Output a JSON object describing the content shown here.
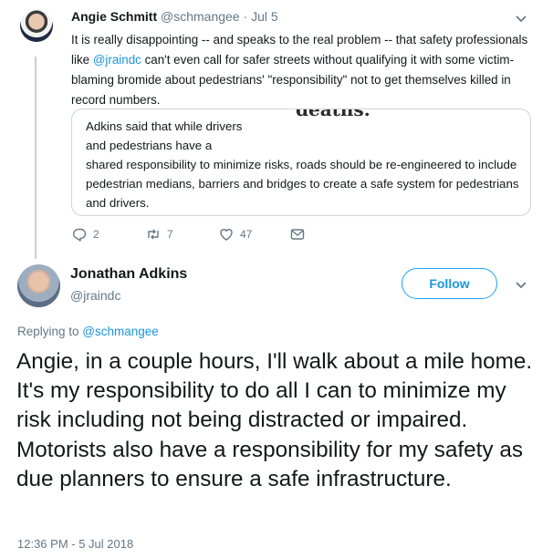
{
  "tweet1": {
    "author_name": "Angie Schmitt",
    "handle": "@schmangee",
    "separator": "·",
    "date": "Jul 5",
    "text_before": "It is really disappointing -- and speaks to the real problem -- that safety professionals like ",
    "mention": "@jraindc",
    "text_after": " can't even call for safer streets without qualifying it with some victim-blaming bromide about pedestrians' \"responsibility\" not to get themselves killed in record numbers.",
    "quote": {
      "headline_fragment": "deaths.",
      "text": "Adkins said that while drivers and pedestrians have a shared responsibility to minimize risks, roads should be re-engineered to include pedestrian medians, barriers and bridges to create a safe system for pedestrians and drivers."
    },
    "actions": {
      "reply_icon": "reply-icon",
      "reply_count": "2",
      "retweet_icon": "retweet-icon",
      "retweet_count": "7",
      "like_icon": "heart-icon",
      "like_count": "47",
      "dm_icon": "envelope-icon"
    }
  },
  "tweet2": {
    "author_name": "Jonathan Adkins",
    "handle": "@jraindc",
    "follow_label": "Follow",
    "replying_prefix": "Replying to ",
    "replying_handle": "@schmangee",
    "text": "Angie, in a couple hours, I'll walk about a mile home. It's my responsibility to do all I can to minimize my risk including not being distracted or impaired. Motorists also have a responsibility for my safety as due planners to ensure a safe infrastructure.",
    "timestamp": "12:36 PM - 5 Jul 2018"
  },
  "colors": {
    "link": "#1b95e0",
    "secondary_text": "#657786",
    "thread_line": "#c4cfd6",
    "border": "#ccd6dd"
  }
}
